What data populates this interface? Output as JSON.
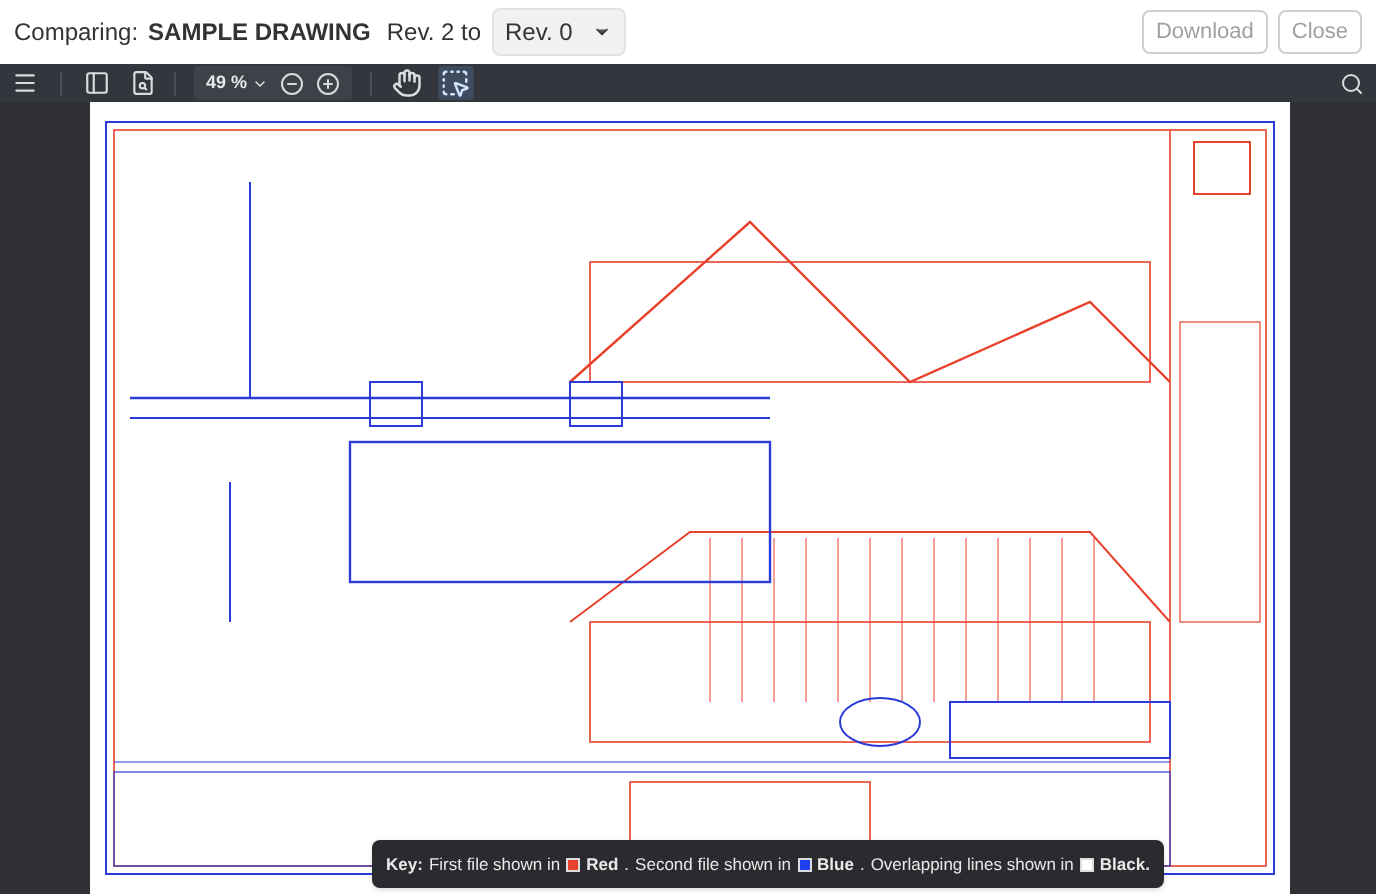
{
  "header": {
    "label": "Comparing:",
    "document": "SAMPLE DRAWING",
    "revision_text": "Rev. 2 to",
    "revision_select": {
      "value": "Rev. 0"
    },
    "buttons": [
      {
        "label": "Download",
        "disabled": true
      },
      {
        "label": "Close",
        "disabled": true
      }
    ]
  },
  "toolbar": {
    "zoom": "49 %",
    "tools": [
      {
        "kind": "pan",
        "selected": false
      },
      {
        "kind": "marquee",
        "selected": true
      }
    ]
  },
  "key": {
    "label": "Key:",
    "entries": [
      {
        "text": "First file shown in",
        "color": "#e8412c",
        "name": "Red",
        "after": "."
      },
      {
        "text": "Second file shown in",
        "color": "#1f3ff0",
        "name": "Blue",
        "after": "."
      },
      {
        "text": "Overlapping lines shown in",
        "color": "#ffffff",
        "name": "Black."
      }
    ]
  }
}
